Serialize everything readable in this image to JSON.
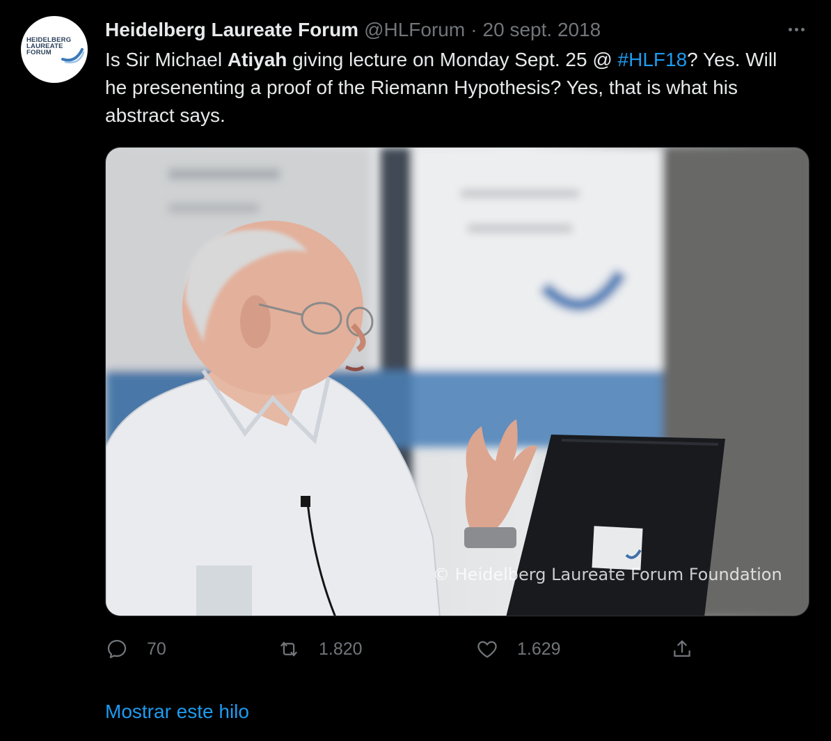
{
  "author": {
    "name": "Heidelberg Laureate Forum",
    "handle": "@HLForum",
    "separator": "·",
    "date": "20 sept. 2018",
    "avatar_logo_lines": [
      "HEIDELBERG",
      "LAUREATE",
      "FORUM"
    ]
  },
  "tweet": {
    "part1": "Is Sir Michael ",
    "bold": "Atiyah",
    "part2": " giving lecture on Monday Sept. 25 @ ",
    "hashtag": "#HLF18",
    "part3": "? Yes. Will he presenenting a proof of the Riemann Hypothesis? Yes, that is what his abstract says."
  },
  "media": {
    "watermark": "© Heidelberg Laureate Forum Foundation"
  },
  "actions": {
    "reply_count": "70",
    "retweet_count": "1.820",
    "like_count": "1.629"
  },
  "icons": {
    "reply": "speech-bubble-icon",
    "retweet": "retweet-icon",
    "like": "heart-icon",
    "share": "share-icon",
    "more": "more-dots-icon"
  },
  "colors": {
    "background": "#000000",
    "text": "#e7e9ea",
    "secondary": "#71767b",
    "accent": "#1d9bf0"
  },
  "thread_link": "Mostrar este hilo"
}
